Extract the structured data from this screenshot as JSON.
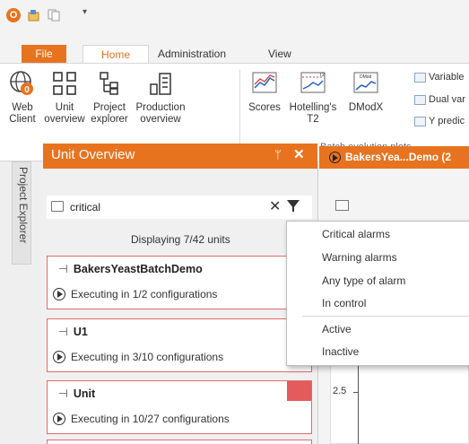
{
  "quick_access": {
    "logo_text": "O",
    "dropdown_glyph": "▾"
  },
  "ribbon_tabs": {
    "file": "File",
    "home": "Home",
    "administration": "Administration",
    "view": "View"
  },
  "ribbon": {
    "buttons": {
      "web_client": {
        "line1": "Web",
        "line2": "Client"
      },
      "unit_overview": {
        "line1": "Unit",
        "line2": "overview"
      },
      "project_explorer": {
        "line1": "Project",
        "line2": "explorer"
      },
      "production_overview": {
        "line1": "Production",
        "line2": "overview"
      },
      "scores": {
        "line1": "Scores"
      },
      "hotellings": {
        "line1": "Hotelling's",
        "line2": "T2"
      },
      "dmodx": {
        "line1": "DModX"
      }
    },
    "small_buttons": [
      "Variable",
      "Dual var",
      "Y predic"
    ],
    "group_label": "Batch evolution plots"
  },
  "project_explorer": {
    "label": "Project Explorer"
  },
  "unit_overview": {
    "title": "Unit Overview",
    "pin_glyph": "ᛘ",
    "close_glyph": "✕",
    "search": {
      "value": "critical"
    },
    "clear_glyph": "✕",
    "displaying": "Displaying 7/42 units",
    "units": [
      {
        "name": "BakersYeastBatchDemo",
        "status": "Executing in 1/2 configurations",
        "alarm": false
      },
      {
        "name": "U1",
        "status": "Executing in 3/10 configurations",
        "alarm": false
      },
      {
        "name": "Unit",
        "status": "Executing in 10/27 configurations",
        "alarm": true
      }
    ]
  },
  "document": {
    "tab_label": "BakersYea...Demo (2",
    "tick_label": "2.5"
  },
  "filter_menu": {
    "items": [
      "Critical alarms",
      "Warning alarms",
      "Any type of alarm",
      "In control",
      "Active",
      "Inactive"
    ]
  },
  "colors": {
    "accent": "#e8731f",
    "alarm": "#e35b5b"
  }
}
